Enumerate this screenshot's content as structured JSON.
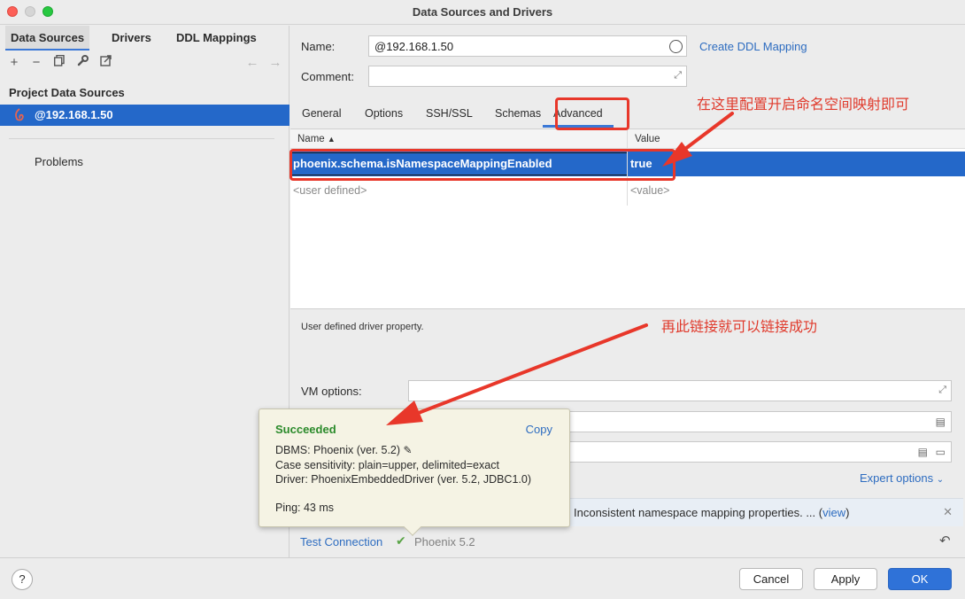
{
  "window": {
    "title": "Data Sources and Drivers"
  },
  "left": {
    "tabs": [
      "Data Sources",
      "Drivers",
      "DDL Mappings"
    ],
    "section_title": "Project Data Sources",
    "datasource": "@192.168.1.50",
    "problems": "Problems",
    "toolbar_icons": [
      "add-icon",
      "remove-icon",
      "duplicate-icon",
      "wrench-icon",
      "jump-icon",
      "back-arrow-icon",
      "forward-arrow-icon"
    ]
  },
  "form": {
    "name_label": "Name:",
    "name_value": "@192.168.1.50",
    "create_ddl": "Create DDL Mapping",
    "comment_label": "Comment:"
  },
  "tabs": [
    "General",
    "Options",
    "SSH/SSL",
    "Schemas",
    "Advanced"
  ],
  "grid": {
    "col_name": "Name",
    "col_value": "Value",
    "rows": [
      {
        "name": "phoenix.schema.isNamespaceMappingEnabled",
        "value": "true"
      },
      {
        "name": "<user defined>",
        "value": "<value>"
      }
    ]
  },
  "description": "User defined driver property.",
  "vm_options_label": "VM options:",
  "expert_options": "Expert options",
  "banner": {
    "text": "Inconsistent namespace mapping properties. ... (",
    "link": "view",
    "tail": ")"
  },
  "test_connection": "Test Connection",
  "connection_status": "Phoenix 5.2",
  "popup": {
    "title": "Succeeded",
    "copy": "Copy",
    "dbms": "DBMS: Phoenix (ver. 5.2)",
    "case": "Case sensitivity: plain=upper, delimited=exact",
    "driver": "Driver: PhoenixEmbeddedDriver (ver. 5.2, JDBC1.0)",
    "ping": "Ping: 43 ms"
  },
  "footer": {
    "help": "?",
    "cancel": "Cancel",
    "apply": "Apply",
    "ok": "OK"
  },
  "annotations": {
    "note1": "在这里配置开启命名空间映射即可",
    "note2": "再此链接就可以链接成功"
  },
  "colors": {
    "accent": "#2468c9",
    "annotation": "#e03a2c",
    "success": "#2a8a2a",
    "link": "#2d6cc0"
  }
}
